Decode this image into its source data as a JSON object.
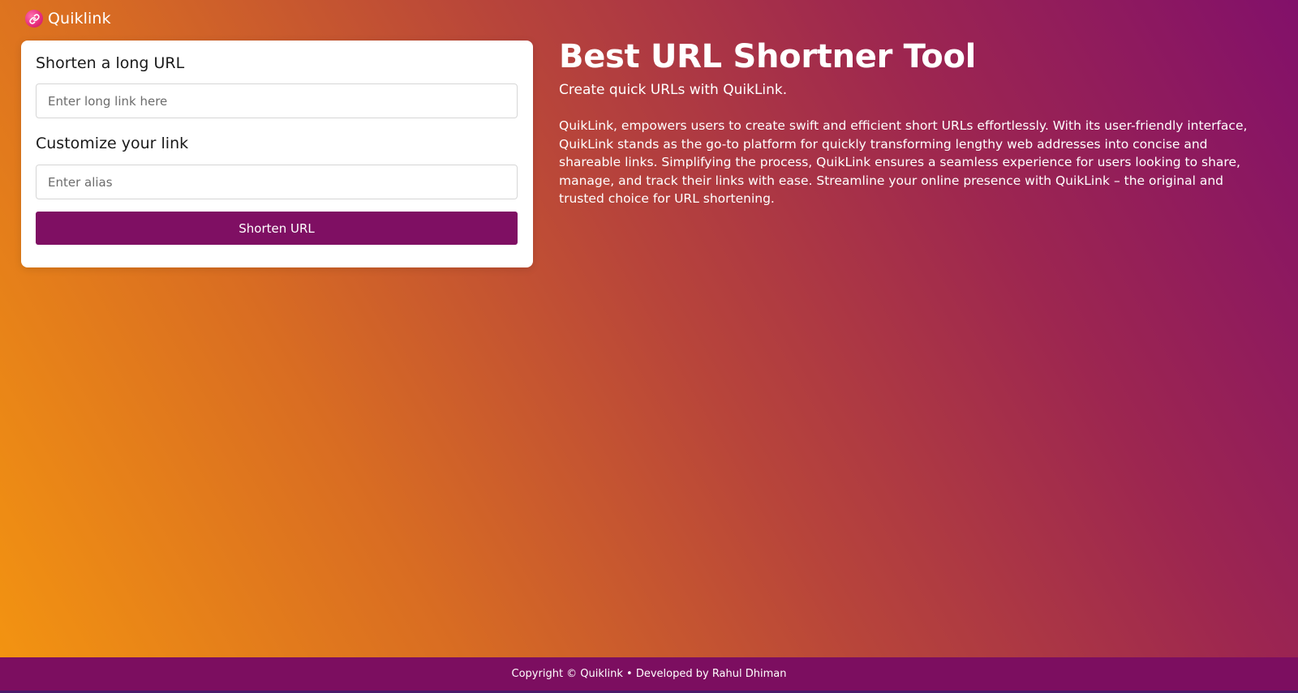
{
  "header": {
    "brand": "Quiklink",
    "logo_icon": "link-icon"
  },
  "form": {
    "long_url_heading": "Shorten a long URL",
    "long_url_placeholder": "Enter long link here",
    "long_url_value": "",
    "alias_heading": "Customize your link",
    "alias_placeholder": "Enter alias",
    "alias_value": "",
    "submit_label": "Shorten URL"
  },
  "hero": {
    "title": "Best URL Shortner Tool",
    "subtitle": "Create quick URLs with QuikLink.",
    "body": "QuikLink, empowers users to create swift and efficient short URLs effortlessly. With its user-friendly interface, QuikLink stands as the go-to platform for quickly transforming lengthy web addresses into concise and shareable links. Simplifying the process, QuikLink ensures a seamless experience for users looking to share, manage, and track their links with ease. Streamline your online presence with QuikLink – the original and trusted choice for URL shortening."
  },
  "footer": {
    "text": "Copyright © Quiklink • Developed by Rahul Dhiman"
  },
  "colors": {
    "accent": "#7f0f63",
    "gradient_start": "#f49510",
    "gradient_end": "#82106a",
    "logo_badge": "#e8307f"
  }
}
